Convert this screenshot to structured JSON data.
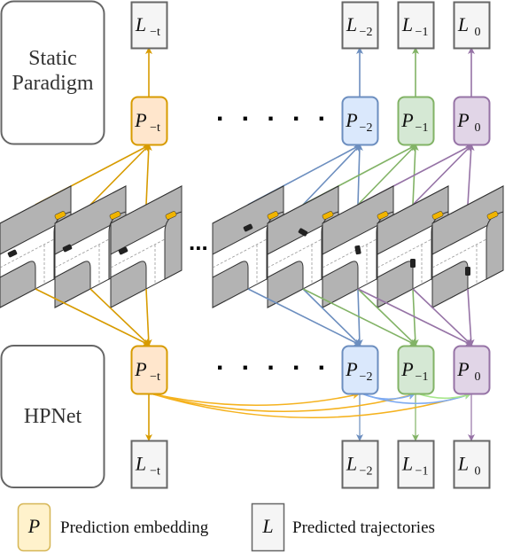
{
  "labels": {
    "static_paradigm": [
      "Static",
      "Paradigm"
    ],
    "hpnet": "HPNet",
    "ellipsis_row": ". . . . .",
    "ellipsis_frames": "..."
  },
  "colors": {
    "orange": "#d79b00",
    "orange_fill": "#ffe6cc",
    "orange_curve": "#f5b21e",
    "blue": "#6c8ebf",
    "blue_fill": "#dae8fc",
    "blue_curve": "#7eaaf0",
    "green": "#82b366",
    "green_fill": "#d5e8d4",
    "green_curve": "#a6e68a",
    "purple": "#9673a6",
    "purple_fill": "#e1d5e7",
    "gray_border": "#666666",
    "gray_fill": "#f5f5f5",
    "frame_gray": "#b3b3b3"
  },
  "columns": [
    {
      "id": "t",
      "p_main": "P",
      "p_sub": "−t",
      "l_main": "L",
      "l_sub": "−t",
      "color": "orange"
    },
    {
      "id": "m2",
      "p_main": "P",
      "p_sub": "−2",
      "l_main": "L",
      "l_sub": "−2",
      "color": "blue"
    },
    {
      "id": "m1",
      "p_main": "P",
      "p_sub": "−1",
      "l_main": "L",
      "l_sub": "−1",
      "color": "green"
    },
    {
      "id": "0",
      "p_main": "P",
      "p_sub": "0",
      "l_main": "L",
      "l_sub": "0",
      "color": "purple"
    }
  ],
  "legend": [
    {
      "symbol": "P",
      "text": "Prediction embedding"
    },
    {
      "symbol": "L",
      "text": "Predicted trajectories"
    }
  ]
}
